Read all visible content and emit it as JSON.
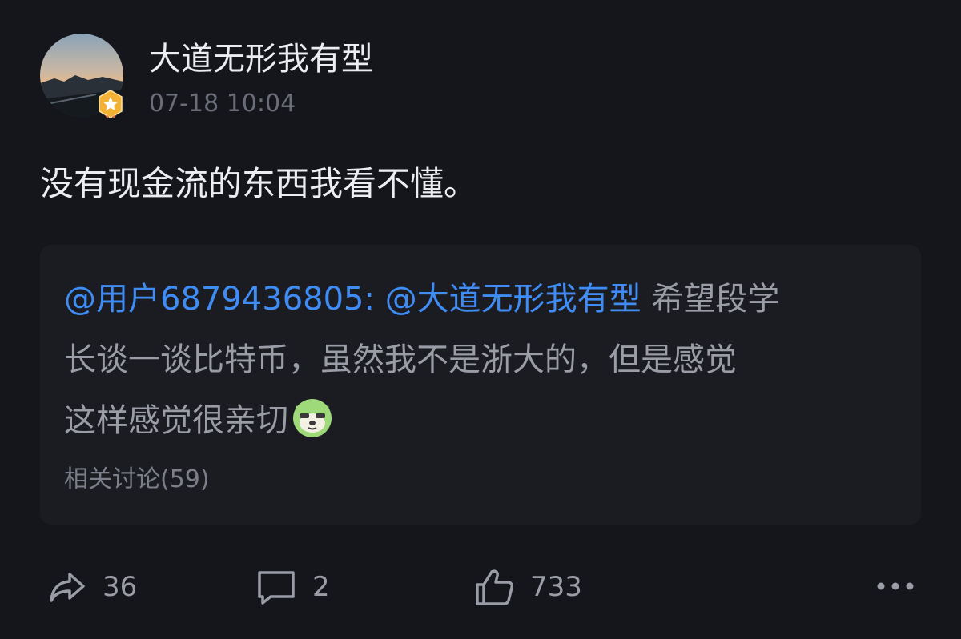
{
  "post": {
    "author": "大道无形我有型",
    "time": "07-18 10:04",
    "text": "没有现金流的东西我看不懂。"
  },
  "quote": {
    "mention_user": "@用户6879436805:",
    "mention_author": "@大道无形我有型",
    "text_line1": " 希望段学",
    "text_line2": "长谈一谈比特币，虽然我不是浙大的，但是感觉",
    "text_line3": "这样感觉很亲切",
    "related": "相关讨论(59)"
  },
  "actions": {
    "share_count": "36",
    "comment_count": "2",
    "like_count": "733"
  },
  "colors": {
    "background": "#15161b",
    "card": "#1b1c22",
    "mention": "#3f8cf5",
    "badge": "#f3b234"
  },
  "icons": {
    "share": "share-icon",
    "comment": "comment-icon",
    "like": "thumbs-up-icon",
    "more": "more-icon",
    "badge": "star-badge-icon",
    "sticker": "dog-sticker-icon"
  }
}
